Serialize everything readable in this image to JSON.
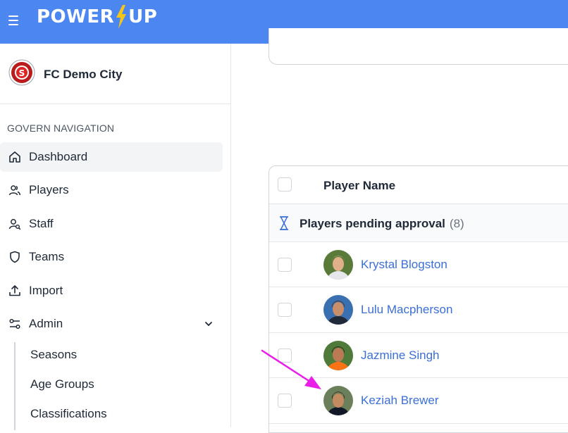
{
  "header": {
    "logo_left": "POWER",
    "logo_right": "UP",
    "colors": {
      "bar": "#4c86f0",
      "bolt": "#f5c518"
    }
  },
  "club": {
    "name": "FC Demo City"
  },
  "nav": {
    "heading": "GOVERN NAVIGATION",
    "items": [
      {
        "label": "Dashboard",
        "icon": "home-icon",
        "active": true
      },
      {
        "label": "Players",
        "icon": "users-icon"
      },
      {
        "label": "Staff",
        "icon": "user-search-icon"
      },
      {
        "label": "Teams",
        "icon": "shield-icon"
      },
      {
        "label": "Import",
        "icon": "upload-icon"
      },
      {
        "label": "Admin",
        "icon": "toggles-icon"
      }
    ],
    "admin_sub": [
      {
        "label": "Seasons"
      },
      {
        "label": "Age Groups"
      },
      {
        "label": "Classifications"
      }
    ]
  },
  "table": {
    "column_header": "Player Name",
    "group": {
      "label": "Players pending approval",
      "count": "(8)"
    },
    "players": [
      {
        "name": "Krystal Blogston"
      },
      {
        "name": "Lulu Macpherson"
      },
      {
        "name": "Jazmine Singh"
      },
      {
        "name": "Keziah Brewer"
      }
    ]
  },
  "annotation": {
    "color": "#e91ee8"
  }
}
